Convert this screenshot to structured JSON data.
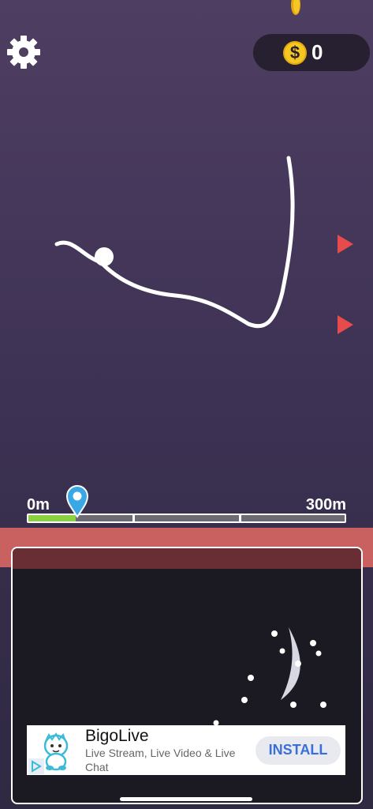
{
  "hud": {
    "coins": "0",
    "coin_symbol": "$",
    "settings_icon": "gear-icon"
  },
  "progress": {
    "start_label": "0m",
    "end_label": "300m",
    "progress_fraction": 0.15
  },
  "ad": {
    "title": "BigoLive",
    "subtitle": "Live Stream, Live Video & Live Chat",
    "install_label": "INSTALL",
    "logo_icon": "bigo-mascot-icon",
    "choices_icon": "ad-choices-icon"
  },
  "colors": {
    "accent_arrow": "#e84b4b",
    "progress_fill": "#8bd142",
    "coin": "#f6c623",
    "marker": "#3aa7e6"
  }
}
